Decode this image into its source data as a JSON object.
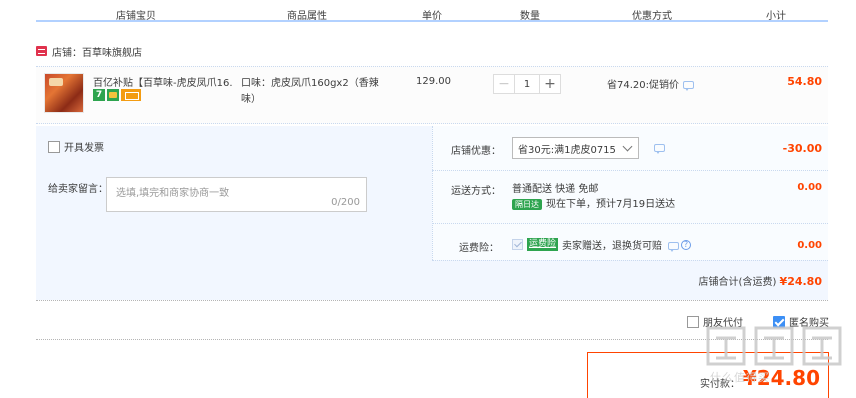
{
  "header": {
    "col_item": "店铺宝贝",
    "col_attr": "商品属性",
    "col_price": "单价",
    "col_qty": "数量",
    "col_promo": "优惠方式",
    "col_subtotal": "小计"
  },
  "shop": {
    "name": "店铺：百草味旗舰店"
  },
  "item": {
    "title": "百亿补贴【百草味-虎皮凤爪16...",
    "badge_seven": "7",
    "attr": "口味：虎皮凤爪160gx2（香辣味）",
    "price": "129.00",
    "qty": "1",
    "minus": "−",
    "plus": "+",
    "promo": "省74.20:促销价",
    "subtotal": "54.80"
  },
  "options": {
    "invoice_label": "开具发票",
    "message_label": "给卖家留言：",
    "message_placeholder": "选填,填完和商家协商一致",
    "message_count": "0/200",
    "discount_label": "店铺优惠：",
    "discount_value": "省30元:满1虎皮0715",
    "discount_amount": "-30.00",
    "shipping_label": "运送方式：",
    "shipping_line1": "普通配送 快递 免邮",
    "shipping_tag": "隔日达",
    "shipping_line2": "现在下单，预计7月19日送达",
    "shipping_amount": "0.00",
    "insurance_label": "运费险：",
    "insurance_tag": "运费险",
    "insurance_text": "卖家赠送，退换货可赔",
    "insurance_q": "?",
    "insurance_amount": "0.00",
    "shop_total_label": "店铺合计(含运费)",
    "shop_total_amount": "¥24.80"
  },
  "footer": {
    "friend_pay": "朋友代付",
    "anonymous": "匿名购买",
    "pay_label": "实付款：",
    "pay_amount": "¥24.80",
    "watermark_text": "什么值得买"
  }
}
